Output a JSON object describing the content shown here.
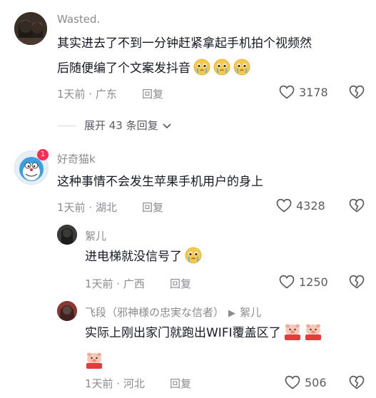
{
  "comments": [
    {
      "username": "Wasted.",
      "text_line1": "其实进去了不到一分钟赶紧拿起手机拍个视频然",
      "text_line2": "后随便编了个文案发抖音",
      "emoji": "crying-face-emoji",
      "meta": "1天前 · 广东",
      "reply_label": "回复",
      "likes": "3178"
    },
    {
      "username": "好奇猫k",
      "text": "这种事情不会发生苹果手机用户的身上",
      "meta": "1天前 · 湖北",
      "reply_label": "回复",
      "likes": "4328"
    }
  ],
  "expand_replies": "展开 43 条回复",
  "replies": [
    {
      "username": "絮儿",
      "text": "进电梯就没信号了",
      "emoji": "crying-face-emoji",
      "meta": "1天前 · 广西",
      "reply_label": "回复",
      "likes": "1250"
    },
    {
      "username": "飞段（邪神様の忠実な信者）",
      "reply_to": "絮儿",
      "text": "实际上刚出家门就跑出WIFI覆盖区了",
      "sticker_label": "求机位",
      "meta": "1天前 · 河北",
      "reply_label": "回复",
      "likes": "506"
    }
  ],
  "colors": {
    "primary_text": "#161823",
    "secondary_text": "#8a8b91"
  }
}
